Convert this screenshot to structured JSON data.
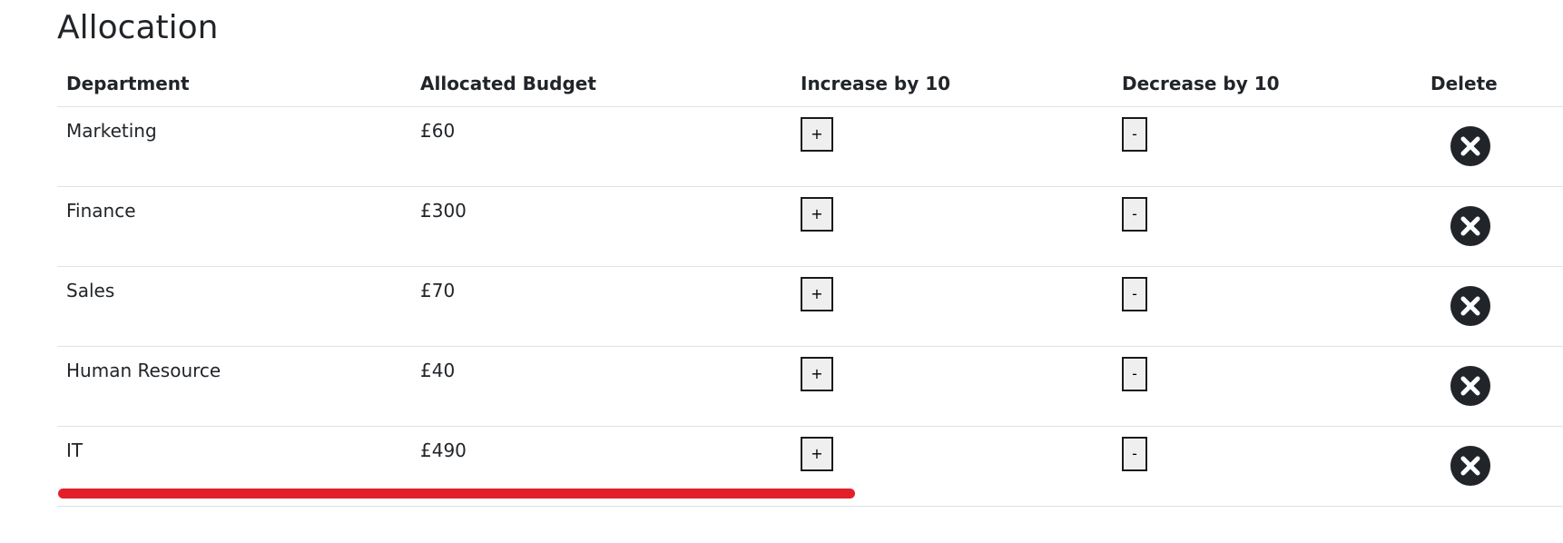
{
  "page": {
    "title": "Allocation"
  },
  "table": {
    "headers": {
      "department": "Department",
      "budget": "Allocated Budget",
      "increase": "Increase by 10",
      "decrease": "Decrease by 10",
      "delete": "Delete"
    },
    "rows": [
      {
        "department": "Marketing",
        "budget": "£60",
        "increase_label": "+",
        "decrease_label": "-"
      },
      {
        "department": "Finance",
        "budget": "£300",
        "increase_label": "+",
        "decrease_label": "-"
      },
      {
        "department": "Sales",
        "budget": "£70",
        "increase_label": "+",
        "decrease_label": "-"
      },
      {
        "department": "Human Resource",
        "budget": "£40",
        "increase_label": "+",
        "decrease_label": "-"
      },
      {
        "department": "IT",
        "budget": "£490",
        "increase_label": "+",
        "decrease_label": "-"
      }
    ]
  },
  "icons": {
    "delete": "close-circle-icon"
  },
  "colors": {
    "delete_icon": "#212529",
    "highlight": "#e2202a",
    "divider": "#dee2e6"
  }
}
